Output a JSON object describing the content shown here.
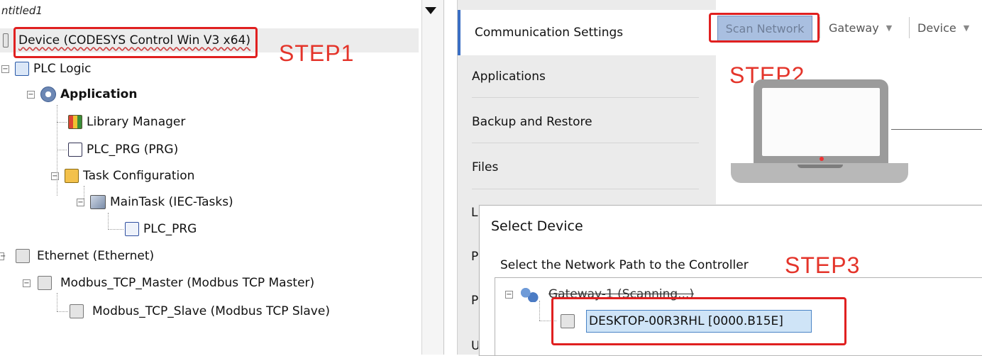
{
  "tree": {
    "project_title": "ntitled1",
    "device": "Device (CODESYS Control Win V3 x64)",
    "plc_logic": "PLC Logic",
    "application": "Application",
    "library_manager": "Library Manager",
    "plc_prg": "PLC_PRG (PRG)",
    "task_configuration": "Task Configuration",
    "main_task": "MainTask (IEC-Tasks)",
    "task_plc_prg": "PLC_PRG",
    "ethernet": "Ethernet (Ethernet)",
    "modbus_master": "Modbus_TCP_Master (Modbus TCP Master)",
    "modbus_slave": "Modbus_TCP_Slave (Modbus TCP Slave)",
    "expand_symbol": "−"
  },
  "nav": {
    "communication_settings": "Communication Settings",
    "applications": "Applications",
    "backup_restore": "Backup and Restore",
    "files": "Files",
    "hidden_l": "L",
    "hidden_p1": "P",
    "hidden_p2": "P",
    "hidden_u": "U"
  },
  "toolbar": {
    "scan_network": "Scan Network",
    "gateway": "Gateway",
    "device": "Device",
    "caret": "▼"
  },
  "dialog": {
    "title": "Select Device",
    "subtitle": "Select the Network Path to the Controller",
    "gateway_node": "Gateway-1 (Scanning...)",
    "device_node": "DESKTOP-00R3RHL [0000.B15E]"
  },
  "steps": {
    "step1": "STEP1",
    "step2": "STEP2",
    "step3": "STEP3"
  },
  "colors": {
    "annotation_red": "#e02020",
    "nav_active_accent": "#3a6fc4",
    "selection_blue": "#cfe4f7"
  }
}
